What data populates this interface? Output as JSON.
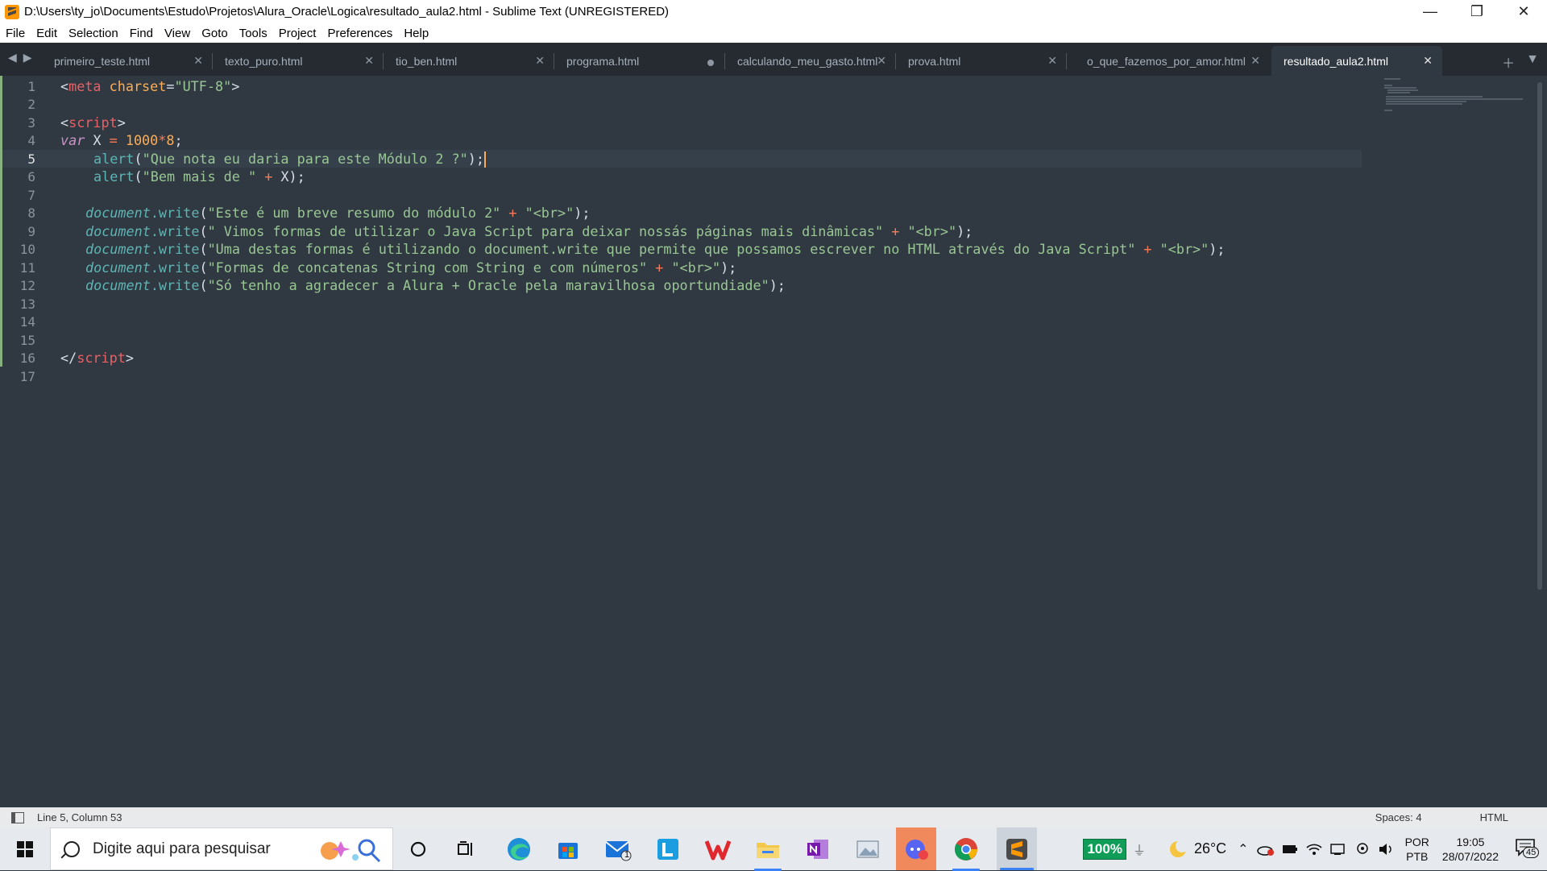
{
  "window": {
    "title": "D:\\Users\\ty_jo\\Documents\\Estudo\\Projetos\\Alura_Oracle\\Logica\\resultado_aula2.html - Sublime Text (UNREGISTERED)",
    "minimize": "—",
    "maximize": "❐",
    "close": "✕"
  },
  "menu": [
    "File",
    "Edit",
    "Selection",
    "Find",
    "View",
    "Goto",
    "Tools",
    "Project",
    "Preferences",
    "Help"
  ],
  "tabs": [
    {
      "label": "primeiro_teste.html",
      "state": "close"
    },
    {
      "label": "texto_puro.html",
      "state": "close"
    },
    {
      "label": "tio_ben.html",
      "state": "close"
    },
    {
      "label": "programa.html",
      "state": "dirty"
    },
    {
      "label": "calculando_meu_gasto.html",
      "state": "close"
    },
    {
      "label": "prova.html",
      "state": "close"
    },
    {
      "label": "o_que_fazemos_por_amor.html",
      "state": "close"
    },
    {
      "label": "resultado_aula2.html",
      "state": "active"
    }
  ],
  "editor": {
    "line_numbers": [
      "1",
      "2",
      "3",
      "4",
      "5",
      "6",
      "7",
      "8",
      "9",
      "10",
      "11",
      "12",
      "13",
      "14",
      "15",
      "16",
      "17"
    ],
    "current_line": 5,
    "colors": {
      "background": "#303841",
      "string": "#99c794",
      "tag": "#ec5f66",
      "keyword": "#c695c6",
      "function": "#5fb4b4",
      "number": "#f9ae58"
    },
    "code": {
      "l1_open": "<",
      "l1_tag": "meta",
      "l1_attr": " charset",
      "l1_eq": "=",
      "l1_val": "\"UTF-8\"",
      "l1_close": ">",
      "l3_open": "<",
      "l3_tag": "script",
      "l3_close": ">",
      "l4_kw": "var",
      "l4_var": " X ",
      "l4_eq": "=",
      "l4_num1": " 1000",
      "l4_mul": "*",
      "l4_num2": "8",
      "l4_semi": ";",
      "l5_fn": "alert",
      "l5_p1": "(",
      "l5_str": "\"Que nota eu daria para este Módulo 2 ?\"",
      "l5_p2": ");",
      "l6_fn": "alert",
      "l6_p1": "(",
      "l6_str": "\"Bem mais de \"",
      "l6_plus": " + ",
      "l6_var": "X",
      "l6_p2": ");",
      "doc": "document",
      "write": ".write",
      "l8_str1": "\"Este é um breve resumo do módulo 2\"",
      "l8_str2": "\"<br>\"",
      "l9_str1": "\" Vimos formas de utilizar o Java Script para deixar nossás páginas mais dinâmicas\"",
      "l9_str2": "\"<br>\"",
      "l10_str1": "\"Uma destas formas é utilizando o document.write que permite que possamos escrever no HTML através do Java Script\"",
      "l10_str2": "\"<br>\"",
      "l11_str1": "\"Formas de concatenas String com String e com números\"",
      "l11_str2": "\"<br>\"",
      "l12_str1": "\"Só tenho a agradecer a Alura + Oracle pela maravilhosa oportundiade\"",
      "plus": " + ",
      "paren_open": "(",
      "paren_close": ");",
      "l16_open": "</",
      "l16_tag": "script",
      "l16_close": ">"
    }
  },
  "status": {
    "position": "Line 5, Column 53",
    "spaces": "Spaces: 4",
    "syntax": "HTML"
  },
  "taskbar": {
    "search_placeholder": "Digite aqui para pesquisar",
    "battery": "100%",
    "weather": "26°C",
    "lang_top": "POR",
    "lang_bottom": "PTB",
    "time": "19:05",
    "date": "28/07/2022",
    "notifications": "45",
    "mail_badge": "1"
  }
}
